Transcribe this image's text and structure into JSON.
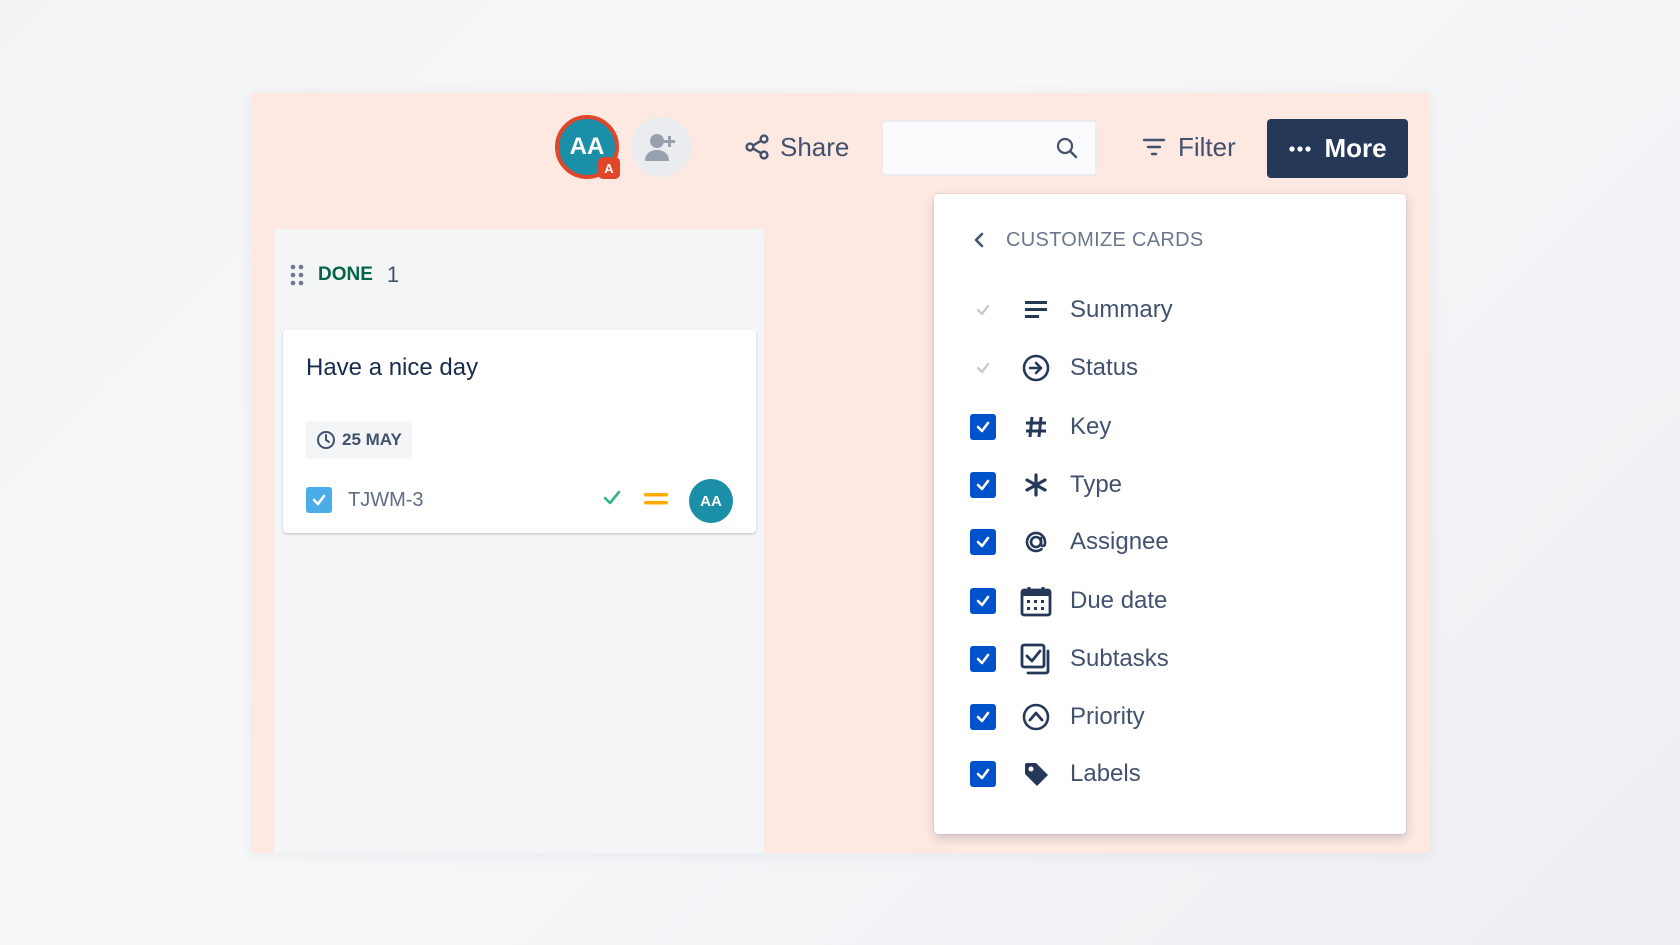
{
  "toolbar": {
    "avatar_initials": "AA",
    "avatar_badge": "A",
    "share_label": "Share",
    "search_placeholder": "",
    "filter_label": "Filter",
    "more_label": "More"
  },
  "column": {
    "title": "DONE",
    "count": "1",
    "card": {
      "title": "Have a nice day",
      "due_date": "25 MAY",
      "issue_key": "TJWM-3",
      "assignee_initials": "AA"
    }
  },
  "menu": {
    "title": "CUSTOMIZE CARDS",
    "items": [
      {
        "label": "Summary",
        "checked": true,
        "disabled": true,
        "icon": "summary-icon"
      },
      {
        "label": "Status",
        "checked": true,
        "disabled": true,
        "icon": "status-icon"
      },
      {
        "label": "Key",
        "checked": true,
        "disabled": false,
        "icon": "hash-icon"
      },
      {
        "label": "Type",
        "checked": true,
        "disabled": false,
        "icon": "asterisk-icon"
      },
      {
        "label": "Assignee",
        "checked": true,
        "disabled": false,
        "icon": "at-icon"
      },
      {
        "label": "Due date",
        "checked": true,
        "disabled": false,
        "icon": "calendar-icon"
      },
      {
        "label": "Subtasks",
        "checked": true,
        "disabled": false,
        "icon": "subtasks-icon"
      },
      {
        "label": "Priority",
        "checked": true,
        "disabled": false,
        "icon": "priority-icon"
      },
      {
        "label": "Labels",
        "checked": true,
        "disabled": false,
        "icon": "label-tag-icon"
      }
    ]
  },
  "colors": {
    "frame_bg": "#fde8e2",
    "more_button": "#253858",
    "checkbox": "#0052cc",
    "done_text": "#006644",
    "avatar": "#1c8fa8",
    "avatar_border": "#e0462a"
  }
}
